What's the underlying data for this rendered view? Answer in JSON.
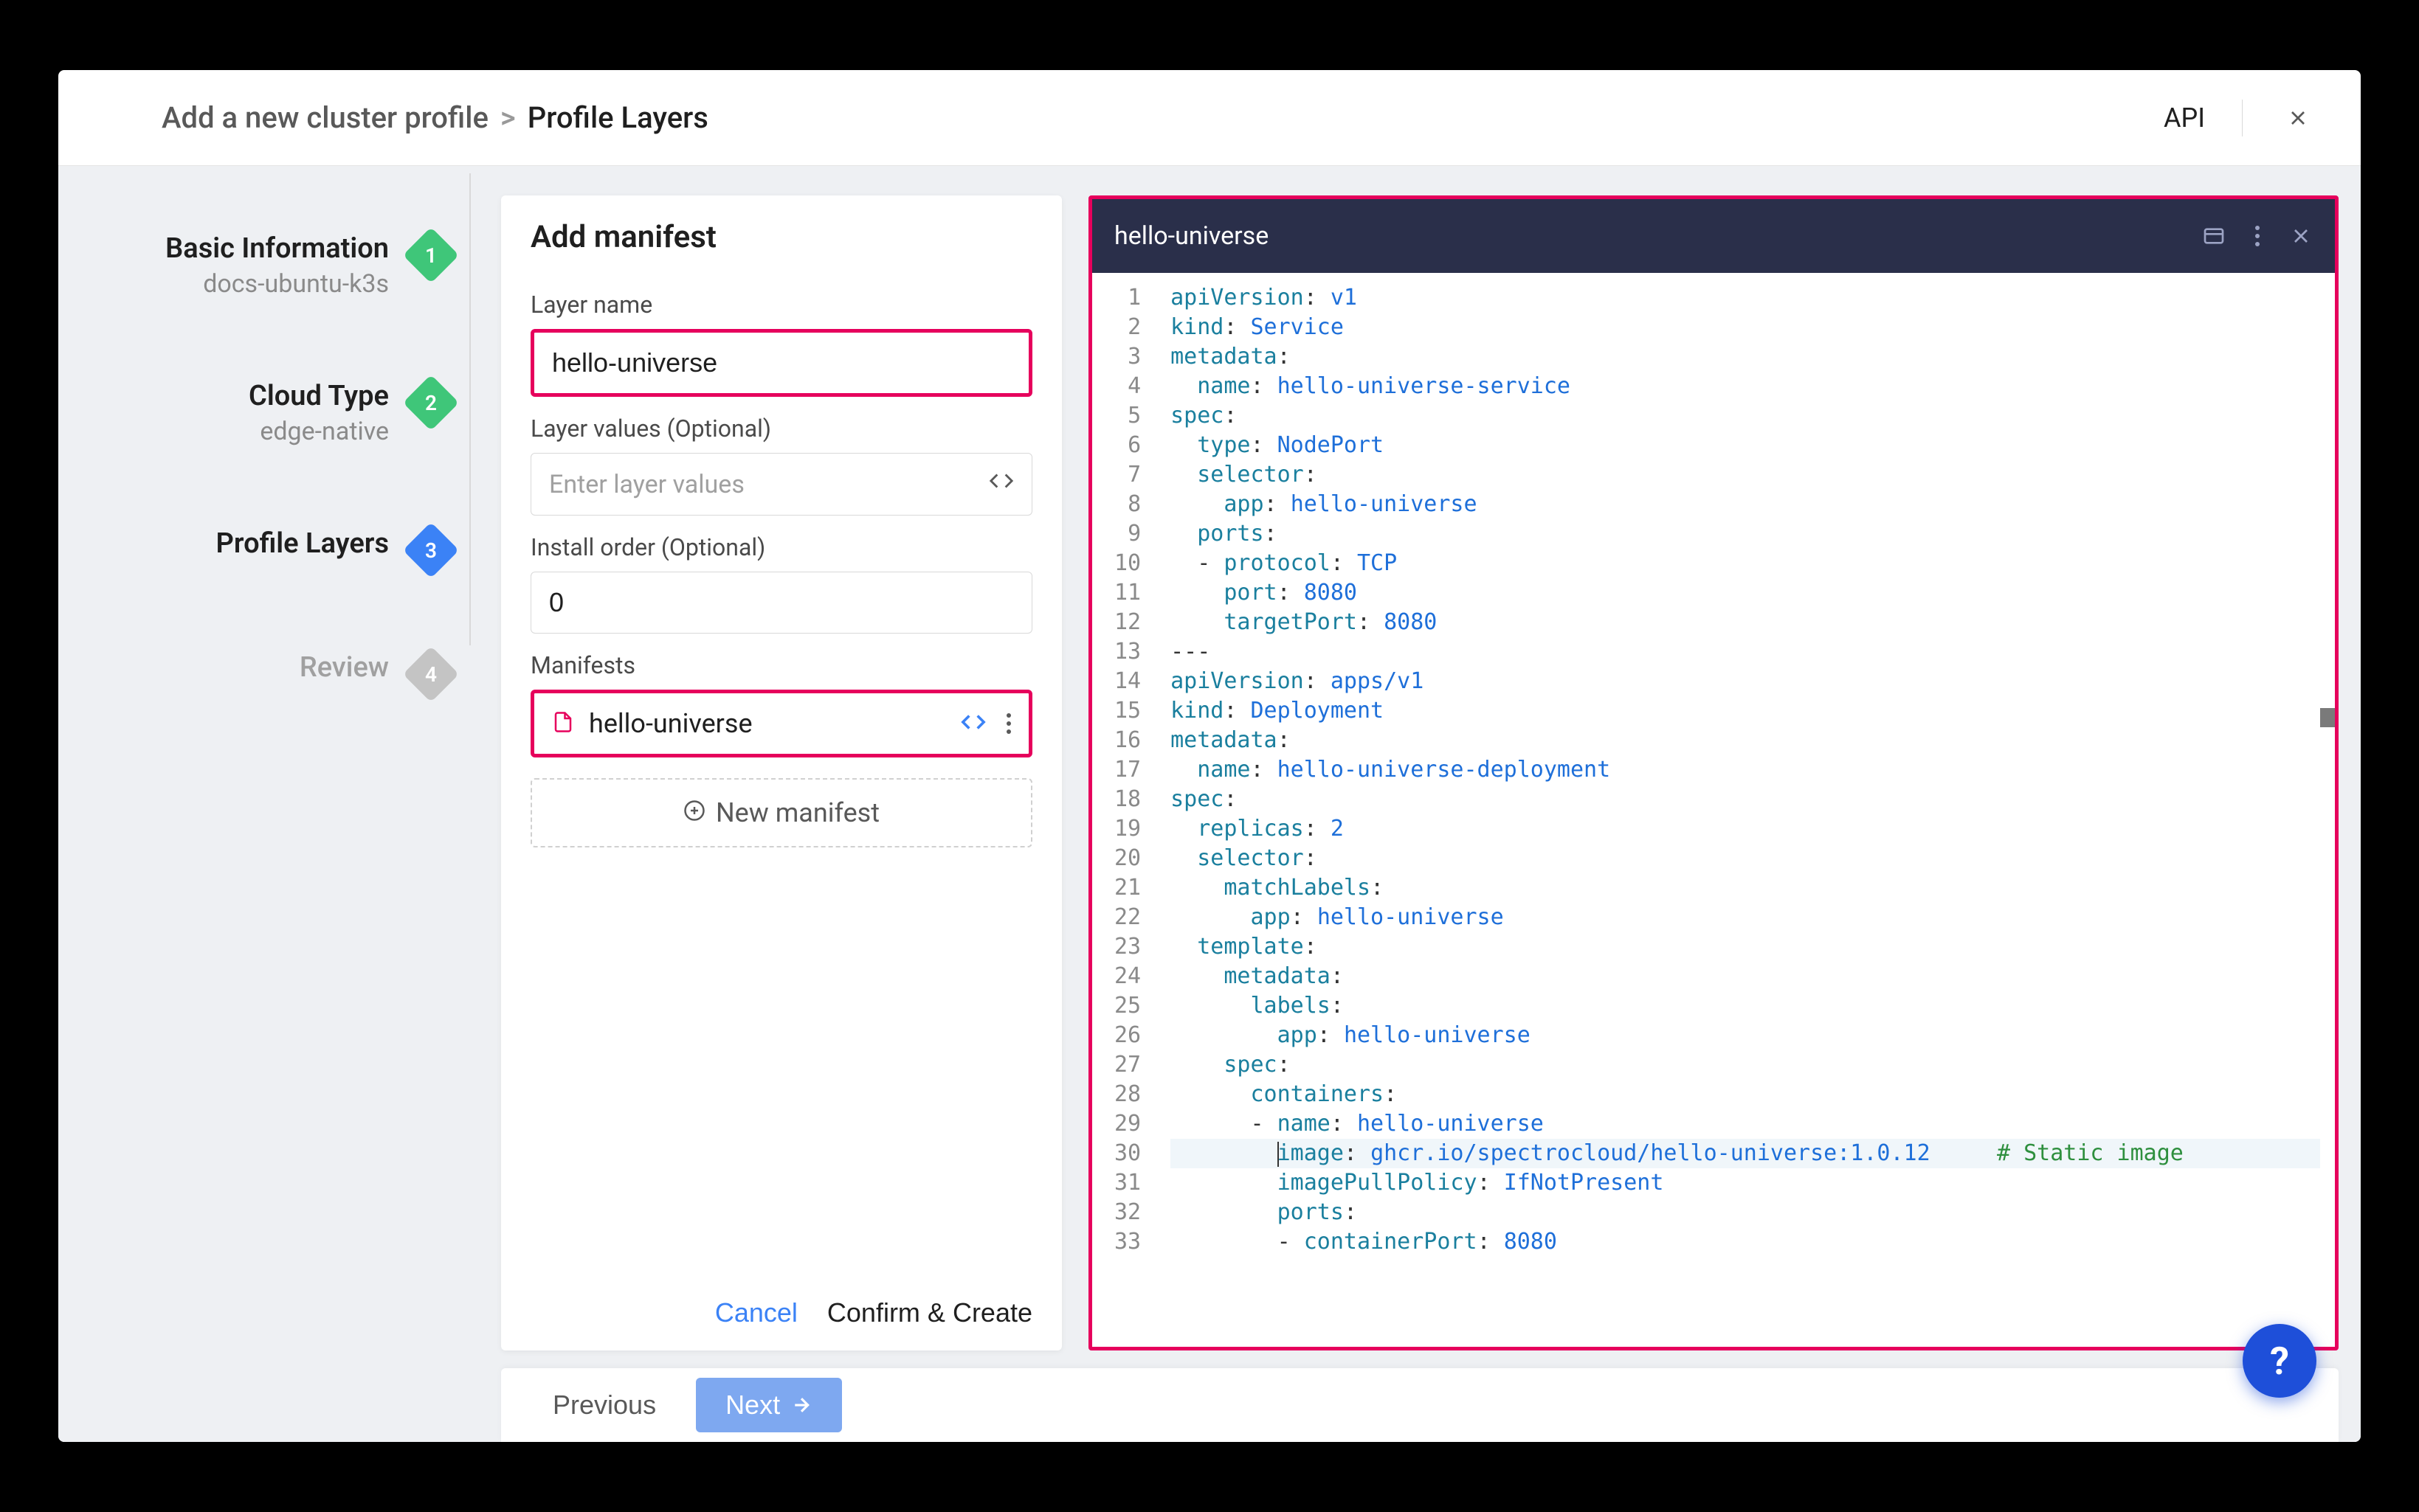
{
  "breadcrumb": {
    "root": "Add a new cluster profile",
    "separator": ">",
    "current": "Profile Layers"
  },
  "titlebar": {
    "api": "API"
  },
  "steps": [
    {
      "title": "Basic Information",
      "sub": "docs-ubuntu-k3s",
      "badge": "1",
      "color": "green"
    },
    {
      "title": "Cloud Type",
      "sub": "edge-native",
      "badge": "2",
      "color": "green"
    },
    {
      "title": "Profile Layers",
      "sub": "",
      "badge": "3",
      "color": "blue"
    },
    {
      "title": "Review",
      "sub": "",
      "badge": "4",
      "color": "gray"
    }
  ],
  "form": {
    "title": "Add manifest",
    "layerNameLabel": "Layer name",
    "layerNameValue": "hello-universe",
    "layerValuesLabel": "Layer values (Optional)",
    "layerValuesPlaceholder": "Enter layer values",
    "installOrderLabel": "Install order (Optional)",
    "installOrderValue": "0",
    "manifestsLabel": "Manifests",
    "manifestItem": "hello-universe",
    "newManifest": "New manifest",
    "cancel": "Cancel",
    "confirm": "Confirm & Create"
  },
  "editor": {
    "title": "hello-universe",
    "lines": [
      [
        {
          "t": "key",
          "v": "apiVersion"
        },
        {
          "t": "punc",
          "v": ": "
        },
        {
          "t": "val",
          "v": "v1"
        }
      ],
      [
        {
          "t": "key",
          "v": "kind"
        },
        {
          "t": "punc",
          "v": ": "
        },
        {
          "t": "val",
          "v": "Service"
        }
      ],
      [
        {
          "t": "key",
          "v": "metadata"
        },
        {
          "t": "punc",
          "v": ":"
        }
      ],
      [
        {
          "t": "punc",
          "v": "  "
        },
        {
          "t": "key",
          "v": "name"
        },
        {
          "t": "punc",
          "v": ": "
        },
        {
          "t": "val",
          "v": "hello-universe-service"
        }
      ],
      [
        {
          "t": "key",
          "v": "spec"
        },
        {
          "t": "punc",
          "v": ":"
        }
      ],
      [
        {
          "t": "punc",
          "v": "  "
        },
        {
          "t": "key",
          "v": "type"
        },
        {
          "t": "punc",
          "v": ": "
        },
        {
          "t": "val",
          "v": "NodePort"
        }
      ],
      [
        {
          "t": "punc",
          "v": "  "
        },
        {
          "t": "key",
          "v": "selector"
        },
        {
          "t": "punc",
          "v": ":"
        }
      ],
      [
        {
          "t": "punc",
          "v": "    "
        },
        {
          "t": "key",
          "v": "app"
        },
        {
          "t": "punc",
          "v": ": "
        },
        {
          "t": "val",
          "v": "hello-universe"
        }
      ],
      [
        {
          "t": "punc",
          "v": "  "
        },
        {
          "t": "key",
          "v": "ports"
        },
        {
          "t": "punc",
          "v": ":"
        }
      ],
      [
        {
          "t": "punc",
          "v": "  - "
        },
        {
          "t": "key",
          "v": "protocol"
        },
        {
          "t": "punc",
          "v": ": "
        },
        {
          "t": "val",
          "v": "TCP"
        }
      ],
      [
        {
          "t": "punc",
          "v": "    "
        },
        {
          "t": "key",
          "v": "port"
        },
        {
          "t": "punc",
          "v": ": "
        },
        {
          "t": "num",
          "v": "8080"
        }
      ],
      [
        {
          "t": "punc",
          "v": "    "
        },
        {
          "t": "key",
          "v": "targetPort"
        },
        {
          "t": "punc",
          "v": ": "
        },
        {
          "t": "num",
          "v": "8080"
        }
      ],
      [
        {
          "t": "punc",
          "v": "---"
        }
      ],
      [
        {
          "t": "key",
          "v": "apiVersion"
        },
        {
          "t": "punc",
          "v": ": "
        },
        {
          "t": "val",
          "v": "apps/v1"
        }
      ],
      [
        {
          "t": "key",
          "v": "kind"
        },
        {
          "t": "punc",
          "v": ": "
        },
        {
          "t": "val",
          "v": "Deployment"
        }
      ],
      [
        {
          "t": "key",
          "v": "metadata"
        },
        {
          "t": "punc",
          "v": ":"
        }
      ],
      [
        {
          "t": "punc",
          "v": "  "
        },
        {
          "t": "key",
          "v": "name"
        },
        {
          "t": "punc",
          "v": ": "
        },
        {
          "t": "val",
          "v": "hello-universe-deployment"
        }
      ],
      [
        {
          "t": "key",
          "v": "spec"
        },
        {
          "t": "punc",
          "v": ":"
        }
      ],
      [
        {
          "t": "punc",
          "v": "  "
        },
        {
          "t": "key",
          "v": "replicas"
        },
        {
          "t": "punc",
          "v": ": "
        },
        {
          "t": "num",
          "v": "2"
        }
      ],
      [
        {
          "t": "punc",
          "v": "  "
        },
        {
          "t": "key",
          "v": "selector"
        },
        {
          "t": "punc",
          "v": ":"
        }
      ],
      [
        {
          "t": "punc",
          "v": "    "
        },
        {
          "t": "key",
          "v": "matchLabels"
        },
        {
          "t": "punc",
          "v": ":"
        }
      ],
      [
        {
          "t": "punc",
          "v": "      "
        },
        {
          "t": "key",
          "v": "app"
        },
        {
          "t": "punc",
          "v": ": "
        },
        {
          "t": "val",
          "v": "hello-universe"
        }
      ],
      [
        {
          "t": "punc",
          "v": "  "
        },
        {
          "t": "key",
          "v": "template"
        },
        {
          "t": "punc",
          "v": ":"
        }
      ],
      [
        {
          "t": "punc",
          "v": "    "
        },
        {
          "t": "key",
          "v": "metadata"
        },
        {
          "t": "punc",
          "v": ":"
        }
      ],
      [
        {
          "t": "punc",
          "v": "      "
        },
        {
          "t": "key",
          "v": "labels"
        },
        {
          "t": "punc",
          "v": ":"
        }
      ],
      [
        {
          "t": "punc",
          "v": "        "
        },
        {
          "t": "key",
          "v": "app"
        },
        {
          "t": "punc",
          "v": ": "
        },
        {
          "t": "val",
          "v": "hello-universe"
        }
      ],
      [
        {
          "t": "punc",
          "v": "    "
        },
        {
          "t": "key",
          "v": "spec"
        },
        {
          "t": "punc",
          "v": ":"
        }
      ],
      [
        {
          "t": "punc",
          "v": "      "
        },
        {
          "t": "key",
          "v": "containers"
        },
        {
          "t": "punc",
          "v": ":"
        }
      ],
      [
        {
          "t": "punc",
          "v": "      - "
        },
        {
          "t": "key",
          "v": "name"
        },
        {
          "t": "punc",
          "v": ": "
        },
        {
          "t": "val",
          "v": "hello-universe"
        }
      ],
      [
        {
          "t": "punc",
          "v": "        "
        },
        {
          "t": "key",
          "v": "image"
        },
        {
          "t": "punc",
          "v": ": "
        },
        {
          "t": "val",
          "v": "ghcr.io/spectrocloud/hello-universe:1.0.12"
        },
        {
          "t": "punc",
          "v": "     "
        },
        {
          "t": "comment",
          "v": "# Static image"
        }
      ],
      [
        {
          "t": "punc",
          "v": "        "
        },
        {
          "t": "key",
          "v": "imagePullPolicy"
        },
        {
          "t": "punc",
          "v": ": "
        },
        {
          "t": "val",
          "v": "IfNotPresent"
        }
      ],
      [
        {
          "t": "punc",
          "v": "        "
        },
        {
          "t": "key",
          "v": "ports"
        },
        {
          "t": "punc",
          "v": ":"
        }
      ],
      [
        {
          "t": "punc",
          "v": "        - "
        },
        {
          "t": "key",
          "v": "containerPort"
        },
        {
          "t": "punc",
          "v": ": "
        },
        {
          "t": "num",
          "v": "8080"
        }
      ]
    ],
    "currentLine": 30
  },
  "footer": {
    "prev": "Previous",
    "next": "Next"
  },
  "helpFab": "?"
}
